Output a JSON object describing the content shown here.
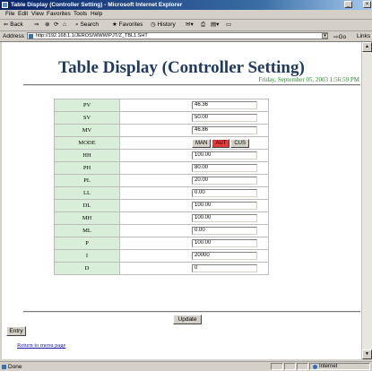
{
  "window": {
    "title": "Table Display (Controller Setting) - Microsoft Internet Explorer",
    "minimize": "_",
    "close": "×"
  },
  "menu": [
    "File",
    "Edit",
    "View",
    "Favorites",
    "Tools",
    "Help"
  ],
  "toolbar": {
    "back": "⇐ Back",
    "forward": "⇒",
    "search": "Search",
    "favorites": "Favorites",
    "history": "History"
  },
  "address": {
    "label": "Address",
    "url": "http://192.168.1.1/JEROS/WWW/PJT/Z_TBL1.SHT",
    "go": "Go",
    "links": "Links"
  },
  "page": {
    "title": "Table Display (Controller Setting)",
    "timestamp": "Friday, September 05, 2003 1:56:59 PM",
    "rows": [
      {
        "label": "PV",
        "value": "46.36"
      },
      {
        "label": "SV",
        "value": "50.00"
      },
      {
        "label": "MV",
        "value": "46.86"
      },
      {
        "label": "MODE",
        "value": ""
      },
      {
        "label": "HH",
        "value": "100.00"
      },
      {
        "label": "PH",
        "value": "80.00"
      },
      {
        "label": "PL",
        "value": "20.00"
      },
      {
        "label": "LL",
        "value": "0.00"
      },
      {
        "label": "DL",
        "value": "100.00"
      },
      {
        "label": "MH",
        "value": "100.00"
      },
      {
        "label": "ML",
        "value": "0.00"
      },
      {
        "label": "P",
        "value": "100.00"
      },
      {
        "label": "I",
        "value": "20000"
      },
      {
        "label": "D",
        "value": "0"
      }
    ],
    "mode_buttons": {
      "man": "MAN",
      "aut": "AUT",
      "cus": "CUS",
      "active": "AUT",
      "active_color": "#e53b3b"
    },
    "update_label": "Update",
    "entry_label": "Entry",
    "return_link": "Return to menu page"
  },
  "status": {
    "text": "Done",
    "zone": "Internet"
  }
}
